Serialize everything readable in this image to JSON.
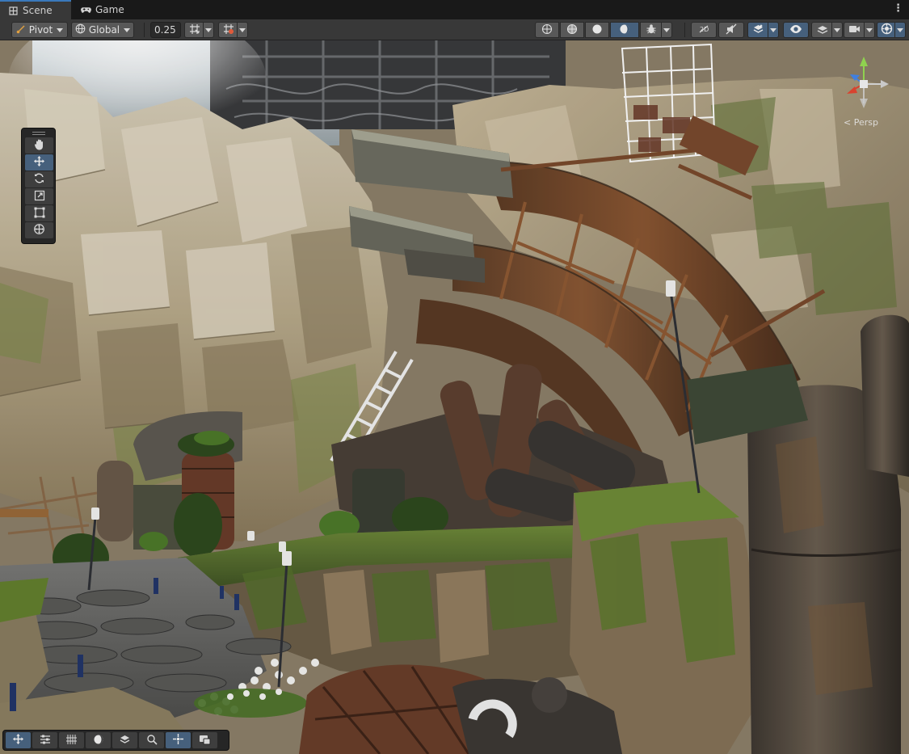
{
  "tabs": [
    {
      "label": "Scene",
      "icon": "grid-icon",
      "active": true
    },
    {
      "label": "Game",
      "icon": "gamepad-icon",
      "active": false
    }
  ],
  "tab_menu_glyph": "⋮",
  "toolbar": {
    "pivot_label": "Pivot",
    "global_label": "Global",
    "snap_value": "0.25",
    "accent_color": "#46607c",
    "button_color": "#585858"
  },
  "tools": [
    {
      "name": "hand-tool",
      "icon": "hand-icon",
      "active": false
    },
    {
      "name": "move-tool",
      "icon": "move-arrows-icon",
      "active": true
    },
    {
      "name": "rotate-tool",
      "icon": "rotate-icon",
      "active": false
    },
    {
      "name": "scale-tool",
      "icon": "scale-icon",
      "active": false
    },
    {
      "name": "rect-tool",
      "icon": "rect-icon",
      "active": false
    },
    {
      "name": "transform-tool",
      "icon": "transform-icon",
      "active": false
    }
  ],
  "gizmo": {
    "label": "< Persp",
    "x_color": "#d8432f",
    "y_color": "#8fd14f",
    "z_color": "#3f7fe0"
  },
  "bottom_tools": [
    {
      "icon": "move-arrows-icon",
      "active": true
    },
    {
      "icon": "sliders-icon",
      "active": false
    },
    {
      "icon": "grid-hatch-icon",
      "active": false
    },
    {
      "icon": "shading-icon",
      "active": false
    },
    {
      "icon": "layers-icon",
      "active": false
    },
    {
      "icon": "search-icon",
      "active": false
    },
    {
      "icon": "crosshair-icon",
      "active": true
    },
    {
      "icon": "camera-overlay-icon",
      "active": false
    }
  ]
}
